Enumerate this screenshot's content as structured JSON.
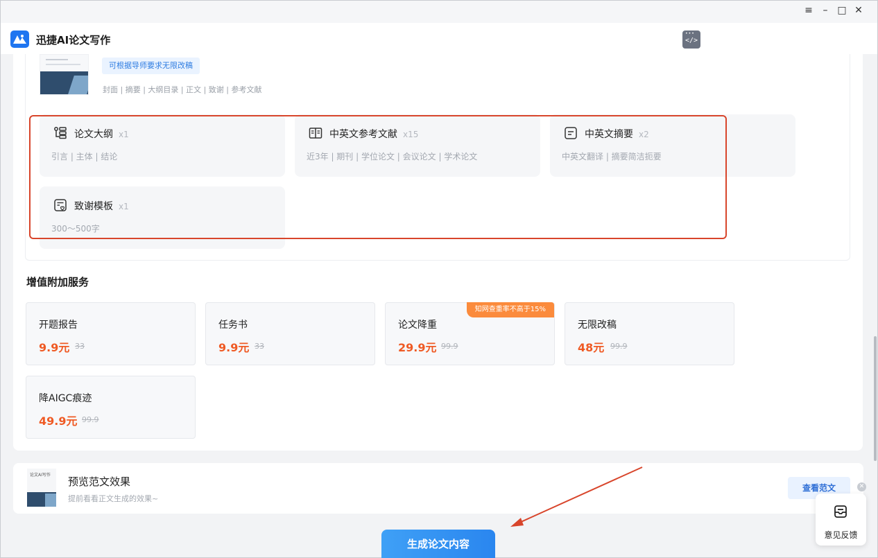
{
  "window": {
    "controls": {
      "menu": "≡",
      "minimize": "–",
      "maximize": "□",
      "close": "✕"
    }
  },
  "app": {
    "title": "迅捷AI论文写作",
    "logo_icon": "app-logo-icon",
    "code_icon": "code-window-icon"
  },
  "template": {
    "tag": "可根据导师要求无限改稿",
    "structure": "封面 | 摘要 | 大纲目录 | 正文 | 致谢 | 参考文献"
  },
  "features": [
    {
      "name": "论文大纲",
      "count": "x1",
      "desc": "引言 | 主体 | 结论",
      "icon": "outline-icon"
    },
    {
      "name": "中英文参考文献",
      "count": "x15",
      "desc": "近3年 | 期刊 | 学位论文 | 会议论文 | 学术论文",
      "icon": "book-icon"
    },
    {
      "name": "中英文摘要",
      "count": "x2",
      "desc": "中英文翻译 | 摘要简洁扼要",
      "icon": "document-icon"
    },
    {
      "name": "致谢模板",
      "count": "x1",
      "desc": "300～500字",
      "icon": "thanks-icon"
    }
  ],
  "services": {
    "title": "增值附加服务",
    "items": [
      {
        "name": "开题报告",
        "price": "9.9元",
        "original": "33"
      },
      {
        "name": "任务书",
        "price": "9.9元",
        "original": "33"
      },
      {
        "name": "论文降重",
        "price": "29.9元",
        "original": "99.9",
        "badge": "知网查重率不高于15%"
      },
      {
        "name": "无限改稿",
        "price": "48元",
        "original": "99.9"
      },
      {
        "name": "降AIGC痕迹",
        "price": "49.9元",
        "original": "99.9"
      }
    ]
  },
  "preview": {
    "thumb_label": "论文AI写作",
    "title": "预览范文效果",
    "subtitle": "提前看看正文生成的效果~",
    "button": "查看范文"
  },
  "feedback": {
    "label": "意见反馈",
    "icon": "feedback-icon"
  },
  "generate_button": "生成论文内容",
  "colors": {
    "accent": "#2a86ef",
    "price": "#ef5a24",
    "highlight_box": "#d8452b",
    "badge": "#fb8b3c"
  }
}
